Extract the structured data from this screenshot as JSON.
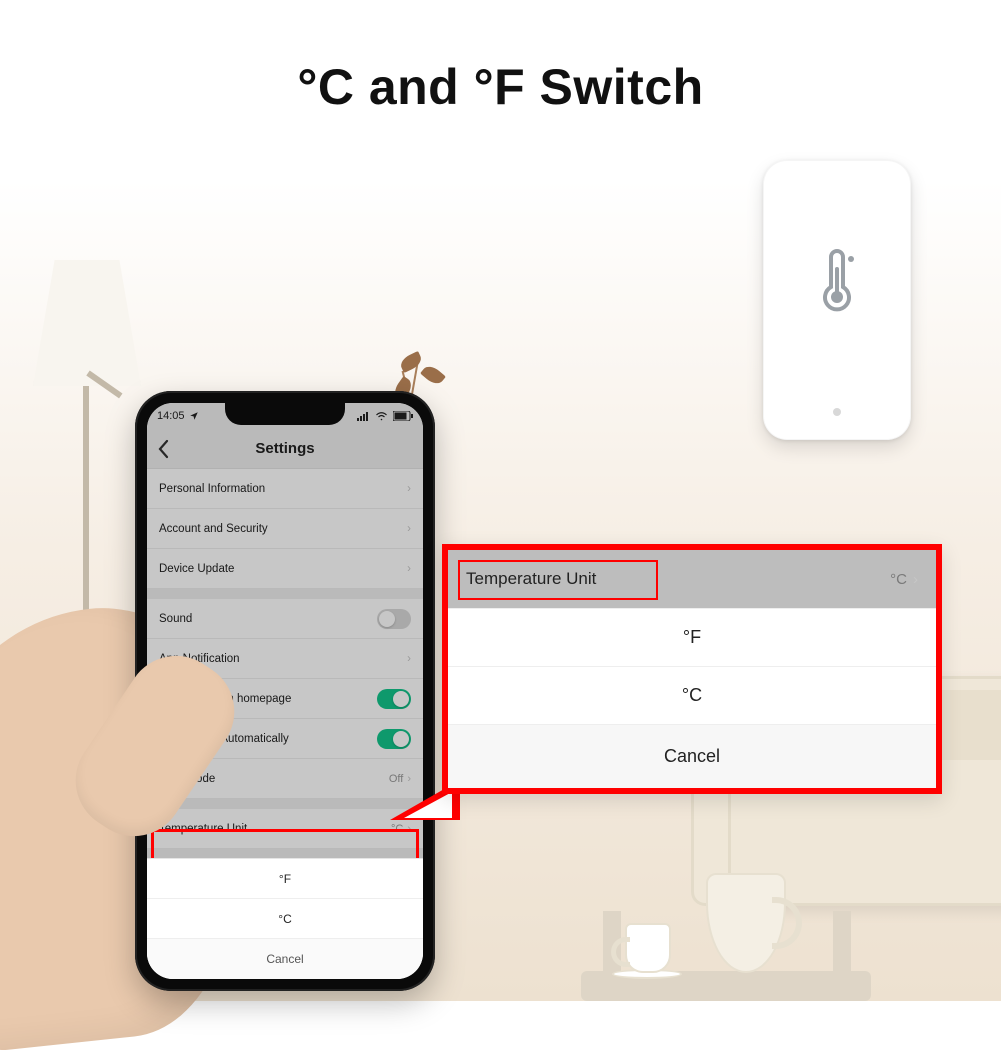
{
  "headline": "°C and °F Switch",
  "statusbar": {
    "time": "14:05",
    "loc_icon": "location-icon"
  },
  "navbar": {
    "title": "Settings"
  },
  "settings": {
    "rows": [
      {
        "label": "Personal Information",
        "type": "link"
      },
      {
        "label": "Account and Security",
        "type": "link"
      },
      {
        "label": "Device Update",
        "type": "link"
      },
      {
        "label": "Sound",
        "type": "toggle",
        "on": false
      },
      {
        "label": "App Notification",
        "type": "link"
      },
      {
        "label": "Scan device in homepage",
        "type": "toggle",
        "on": true
      },
      {
        "label": "Add Device Automatically",
        "type": "toggle",
        "on": true
      },
      {
        "label": "Dark Mode",
        "type": "value",
        "value": "Off"
      },
      {
        "label": "Temperature Unit",
        "type": "value",
        "value": "°C"
      }
    ]
  },
  "sheet": {
    "options": [
      "°F",
      "°C"
    ],
    "cancel": "Cancel"
  },
  "callout": {
    "row_label": "Temperature Unit",
    "row_value": "°C",
    "options": [
      "°F",
      "°C"
    ],
    "cancel": "Cancel"
  }
}
